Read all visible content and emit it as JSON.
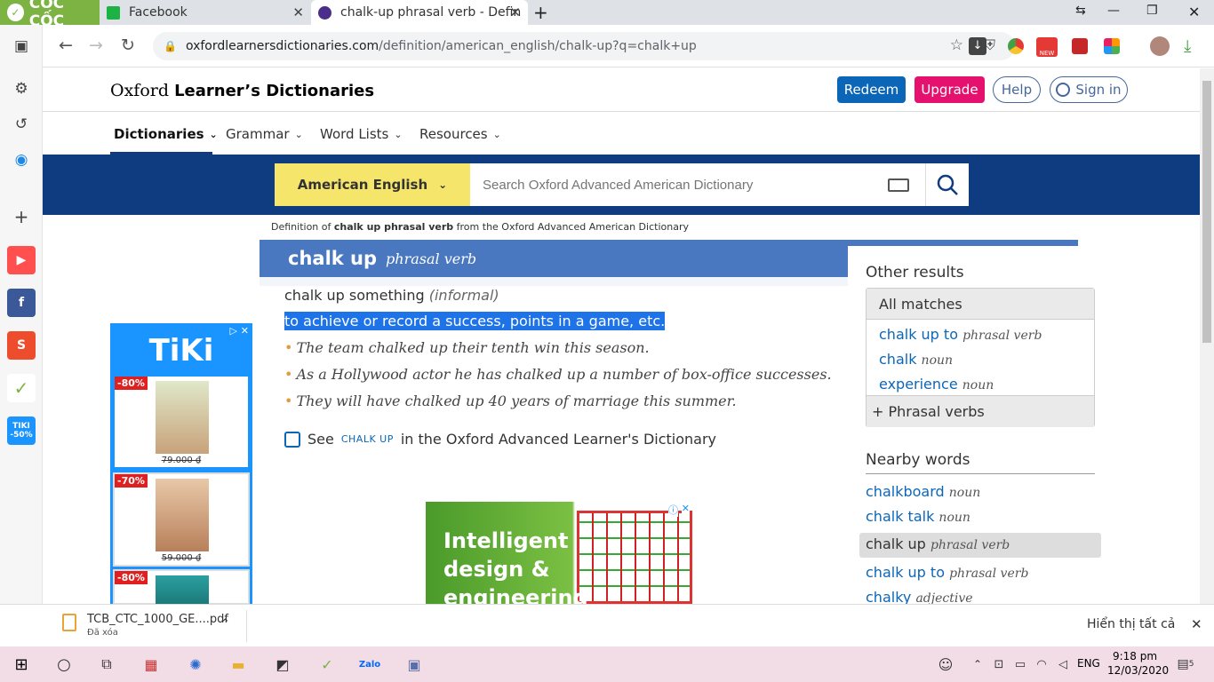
{
  "browser": {
    "brand": "CỐC CỐC",
    "tabs": [
      {
        "title": "Facebook"
      },
      {
        "title": "chalk-up phrasal verb - Defin"
      }
    ],
    "url_host": "oxfordlearnersdictionaries.com",
    "url_path": "/definition/american_english/chalk-up?q=chalk+up",
    "ext_new_label": "NEW"
  },
  "sidebar": {
    "tiki_label": "TIKI -50%"
  },
  "site": {
    "logo_oxford": "Oxford",
    "logo_rest": "Learner’s Dictionaries",
    "redeem": "Redeem",
    "upgrade": "Upgrade",
    "help": "Help",
    "signin": "Sign in",
    "menu": [
      "Dictionaries",
      "Grammar",
      "Word Lists",
      "Resources"
    ],
    "dict_selector": "American English",
    "search_placeholder": "Search Oxford Advanced American Dictionary"
  },
  "entry": {
    "definition_of_prefix": "Definition of",
    "definition_of_term": "chalk up phrasal verb",
    "definition_of_suffix": "from the Oxford Advanced American Dictionary",
    "headword": "chalk up",
    "pos": "phrasal verb",
    "sense": "chalk up something",
    "register": "(informal)",
    "definition": "to achieve or record a success, points in a game, etc.",
    "examples": [
      "The team chalked up their tenth win this season.",
      "As a Hollywood actor he has chalked up a number of box-office successes.",
      "They will have chalked up 40 years of marriage this summer."
    ],
    "see_prefix": "See",
    "see_term": "chalk up",
    "see_suffix": "in the Oxford Advanced Learner's Dictionary"
  },
  "other_results": {
    "title": "Other results",
    "all_matches": "All matches",
    "matches": [
      {
        "word": "chalk up to",
        "pos": "phrasal verb"
      },
      {
        "word": "chalk",
        "pos": "noun"
      },
      {
        "word": "experience",
        "pos": "noun"
      }
    ],
    "phrasal_verbs": "Phrasal verbs"
  },
  "nearby": {
    "title": "Nearby words",
    "words": [
      {
        "word": "chalkboard",
        "pos": "noun"
      },
      {
        "word": "chalk talk",
        "pos": "noun"
      },
      {
        "word": "chalk up",
        "pos": "phrasal verb"
      },
      {
        "word": "chalk up to",
        "pos": "phrasal verb"
      },
      {
        "word": "chalky",
        "pos": "adjective"
      }
    ]
  },
  "ads": {
    "tiki_brand": "TiKi",
    "tiki_items": [
      {
        "discount": "-80%",
        "price": "79.000 ₫"
      },
      {
        "discount": "-70%",
        "price": "59.000 ₫"
      },
      {
        "discount": "-80%",
        "price": ""
      }
    ],
    "ad2_text_1": "Intelligent",
    "ad2_text_2": "design &",
    "ad2_text_3": "engineering"
  },
  "download": {
    "filename": "TCB_CTC_1000_GE....pdf",
    "status": "Đã xóa",
    "show_all": "Hiển thị tất cả"
  },
  "taskbar": {
    "lang": "ENG",
    "time": "9:18 pm",
    "date": "12/03/2020",
    "notif_count": "5"
  },
  "colors": {
    "oxford_blue": "#0f3b80",
    "entry_header": "#4a78c0",
    "redeem": "#0c66b8",
    "upgrade": "#e4116f",
    "dict_selector": "#f5e56b",
    "highlight": "#1e73e8",
    "coccoc_green": "#7cb342",
    "tiki_blue": "#1a94ff"
  }
}
